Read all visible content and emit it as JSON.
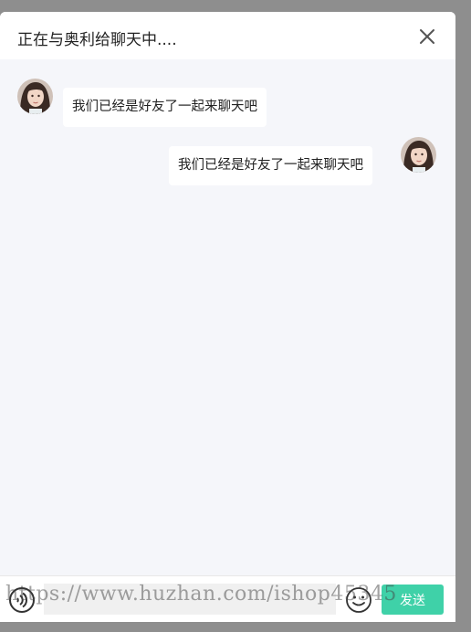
{
  "header": {
    "title": "正在与奥利给聊天中....",
    "close_icon": "close-icon"
  },
  "messages": [
    {
      "side": "left",
      "text": "我们已经是好友了一起来聊天吧",
      "avatar": "avatar-image"
    },
    {
      "side": "right",
      "text": "我们已经是好友了一起来聊天吧",
      "avatar": "avatar-image"
    }
  ],
  "footer": {
    "voice_icon": "voice-icon",
    "input_value": "",
    "emoji_icon": "emoji-icon",
    "send_label": "发送"
  },
  "watermark": "https://www.huzhan.com/ishop45345",
  "colors": {
    "accent": "#3fd1a8",
    "chat_background": "#f5f6fa",
    "overlay": "#8e8e8e"
  }
}
